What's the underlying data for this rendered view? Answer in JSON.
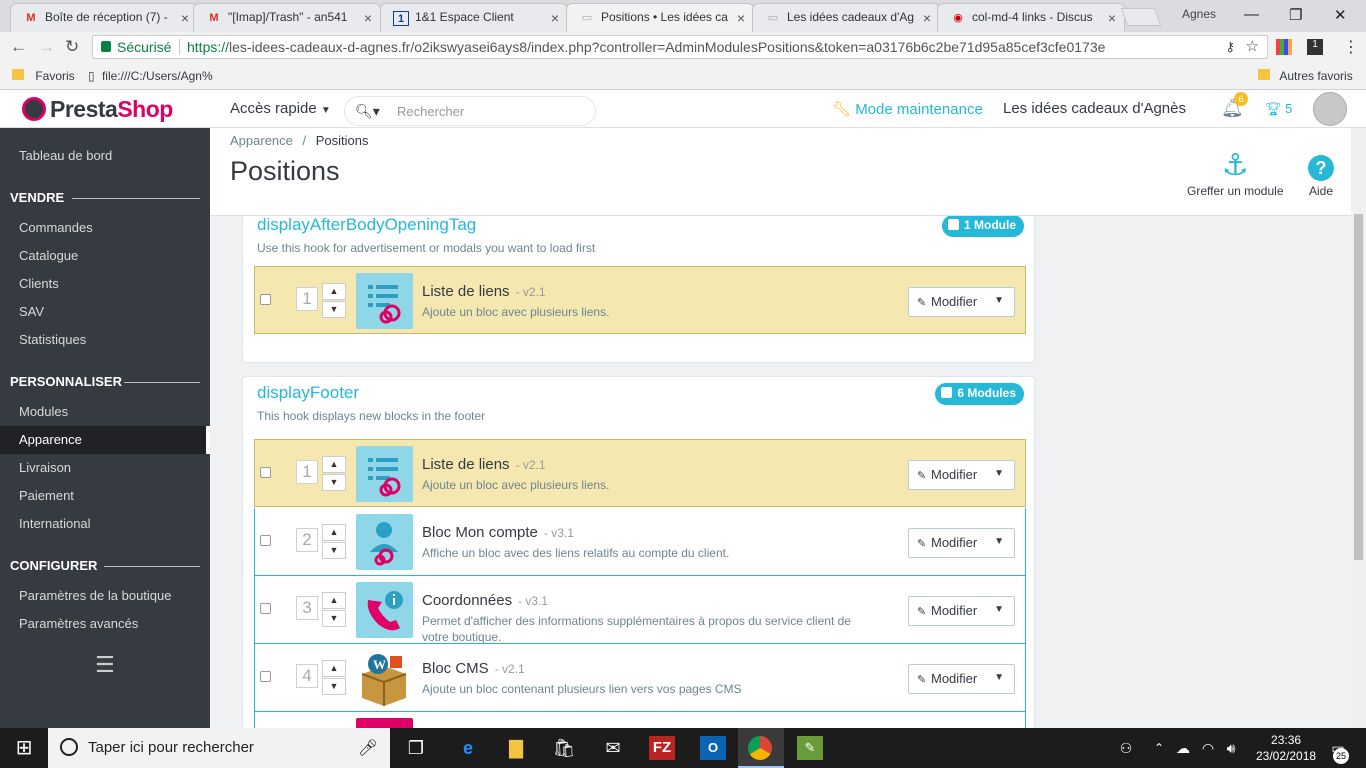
{
  "browser": {
    "tabs": [
      {
        "title": "Boîte de réception (7) -",
        "icon": "gmail-icon"
      },
      {
        "title": "\"[Imap]/Trash\" - an541",
        "icon": "gmail-icon"
      },
      {
        "title": "1&1 Espace Client",
        "icon": "ionos-icon"
      },
      {
        "title": "Positions • Les idées ca",
        "icon": "prestashop-icon"
      },
      {
        "title": "Les idées cadeaux d'Ag",
        "icon": "page-icon"
      },
      {
        "title": "col-md-4 links - Discus",
        "icon": "forum-icon"
      }
    ],
    "profile_name": "Agnes",
    "secure_label": "Sécurisé",
    "url_scheme": "https://",
    "url_rest": "les-idees-cadeaux-d-agnes.fr/o2ikswyasei6ays8/index.php?controller=AdminModulesPositions&token=a03176b6c2be71d95a85cef3cfe0173e",
    "bookmarks": [
      {
        "label": "Favoris"
      },
      {
        "label": "file:///C:/Users/Agn%"
      }
    ],
    "other_bookmarks": "Autres favoris"
  },
  "header": {
    "logo_presta": "Presta",
    "logo_shop": "Shop",
    "quick_access": "Accès rapide",
    "search_placeholder": "Rechercher",
    "maintenance": "Mode maintenance",
    "shop_name": "Les idées cadeaux d'Agnès",
    "notification_count": "6",
    "trophy_count": "5"
  },
  "sidebar": {
    "dashboard": "Tableau de bord",
    "section_sell": "VENDRE",
    "sell_items": [
      "Commandes",
      "Catalogue",
      "Clients",
      "SAV",
      "Statistiques"
    ],
    "section_customize": "PERSONNALISER",
    "customize_items": [
      "Modules",
      "Apparence",
      "Livraison",
      "Paiement",
      "International"
    ],
    "section_configure": "CONFIGURER",
    "configure_items": [
      "Paramètres de la boutique",
      "Paramètres avancés"
    ],
    "active": "Apparence"
  },
  "page": {
    "breadcrumb_parent": "Apparence",
    "breadcrumb_sep": "/",
    "breadcrumb_current": "Positions",
    "title": "Positions",
    "toolbar_hook": "Greffer un module",
    "toolbar_help": "Aide"
  },
  "hooks": [
    {
      "name": "displayAfterBodyOpeningTag",
      "description": "Use this hook for advertisement or modals you want to load first",
      "count_label": "1 Module",
      "modules": [
        {
          "position": "1",
          "name": "Liste de liens",
          "version": "- v2.1",
          "description": "Ajoute un bloc avec plusieurs liens.",
          "icon": "link-list-icon",
          "highlighted": true
        }
      ]
    },
    {
      "name": "displayFooter",
      "description": "This hook displays new blocks in the footer",
      "count_label": "6 Modules",
      "modules": [
        {
          "position": "1",
          "name": "Liste de liens",
          "version": "- v2.1",
          "description": "Ajoute un bloc avec plusieurs liens.",
          "icon": "link-list-icon",
          "highlighted": true
        },
        {
          "position": "2",
          "name": "Bloc Mon compte",
          "version": "- v3.1",
          "description": "Affiche un bloc avec des liens relatifs au compte du client.",
          "icon": "account-icon",
          "highlighted": false
        },
        {
          "position": "3",
          "name": "Coordonnées",
          "version": "- v3.1",
          "description": "Permet d'afficher des informations supplémentaires à propos du service client de votre boutique.",
          "icon": "contact-phone-icon",
          "highlighted": false
        },
        {
          "position": "4",
          "name": "Bloc CMS",
          "version": "- v2.1",
          "description": "Ajoute un bloc contenant plusieurs lien vers vos pages CMS",
          "icon": "cms-box-icon",
          "highlighted": false
        }
      ]
    }
  ],
  "edit_button_label": "Modifier",
  "taskbar": {
    "search_placeholder": "Taper ici pour rechercher",
    "time": "23:36",
    "date": "23/02/2018",
    "notifications": "25"
  },
  "colors": {
    "accent": "#25b9d7",
    "brand_pink": "#df0067",
    "sidebar_bg": "#363a41",
    "highlight_row": "#f4e8b0"
  }
}
